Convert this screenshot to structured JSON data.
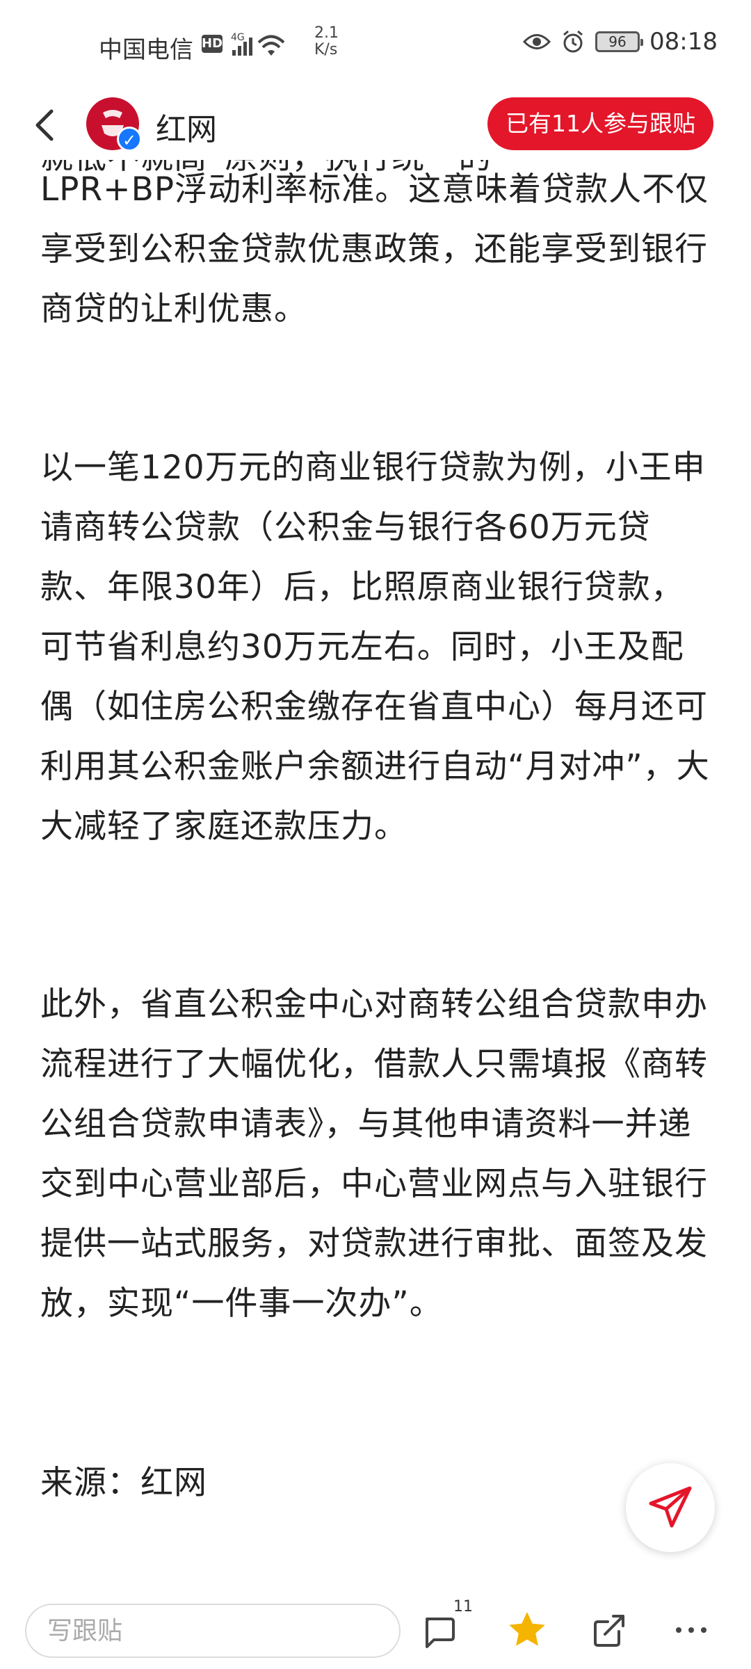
{
  "status_bar": {
    "carrier": "中国电信",
    "hd": "HD",
    "network": "4G",
    "speed_value": "2.1",
    "speed_unit": "K/s",
    "battery": "96",
    "time": "08:18"
  },
  "header": {
    "source_name": "红网",
    "follow_label": "已有11人参与跟贴"
  },
  "article": {
    "partial_top_line": "就低不就高”原则，执行统一的",
    "paragraphs": [
      "LPR+BP浮动利率标准。这意味着贷款人不仅享受到公积金贷款优惠政策，还能享受到银行商贷的让利优惠。",
      "以一笔120万元的商业银行贷款为例，小王申请商转公贷款（公积金与银行各60万元贷款、年限30年）后，比照原商业银行贷款，可节省利息约30万元左右。同时，小王及配偶（如住房公积金缴存在省直中心）每月还可利用其公积金账户余额进行自动“月对冲”，大大减轻了家庭还款压力。",
      "此外，省直公积金中心对商转公组合贷款申办流程进行了大幅优化，借款人只需填报《商转公组合贷款申请表》，与其他申请资料一并递交到中心营业部后，中心营业网点与入驻银行提供一站式服务，对贷款进行审批、面签及发放，实现“一件事一次办”。",
      "来源：红网"
    ]
  },
  "bottom_bar": {
    "comment_placeholder": "写跟贴",
    "comment_count": "11"
  },
  "icons": {
    "back": "back-arrow-icon",
    "share_fab": "send-icon",
    "comment": "comment-icon",
    "favorite": "star-icon",
    "share": "share-icon",
    "more": "more-icon"
  },
  "colors": {
    "accent": "#e4162a",
    "star": "#f5b400",
    "verified": "#1677ff"
  }
}
